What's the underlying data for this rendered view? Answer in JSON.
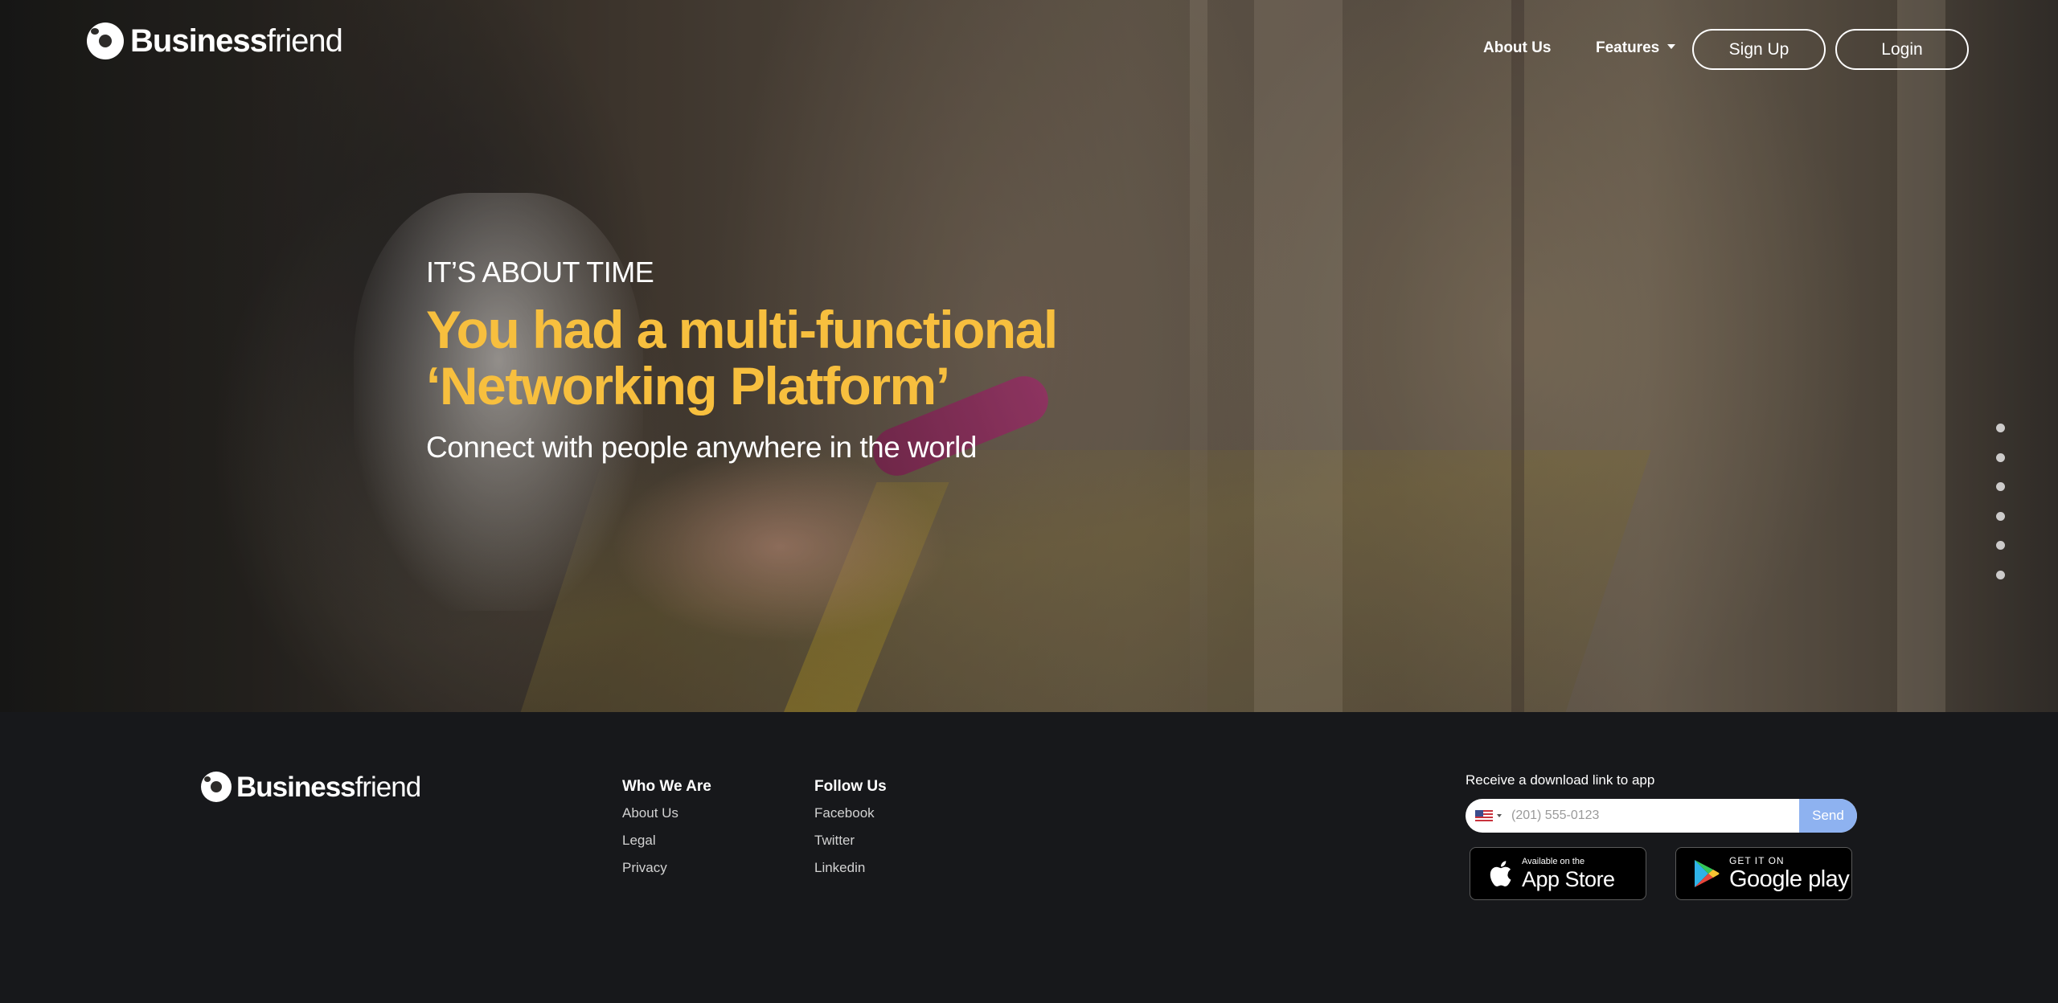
{
  "brand": {
    "name_bold": "Business",
    "name_light": "friend"
  },
  "nav": {
    "about": "About Us",
    "features": "Features",
    "signup": "Sign Up",
    "login": "Login"
  },
  "hero": {
    "kicker": "IT’S ABOUT TIME",
    "headline_line1": "You had a multi-functional",
    "headline_line2": "‘Networking Platform’",
    "subhead": "Connect with people anywhere in the world",
    "slide_count": 6
  },
  "footer": {
    "who_we_are": {
      "heading": "Who We Are",
      "links": [
        "About Us",
        "Legal",
        "Privacy"
      ]
    },
    "follow_us": {
      "heading": "Follow Us",
      "links": [
        "Facebook",
        "Twitter",
        "Linkedin"
      ]
    },
    "download": {
      "label": "Receive a download link to app",
      "placeholder": "(201) 555-0123",
      "send": "Send"
    },
    "app_store": {
      "small": "Available on the",
      "big": "App Store"
    },
    "google_play": {
      "small": "GET IT ON",
      "big": "Google play"
    }
  },
  "colors": {
    "headline": "#f7bf3e",
    "footer_bg": "#17181b",
    "send_button": "#8eb2f0"
  },
  "icons": [
    "us-flag-icon",
    "apple-icon",
    "google-play-icon",
    "caret-down-icon"
  ]
}
